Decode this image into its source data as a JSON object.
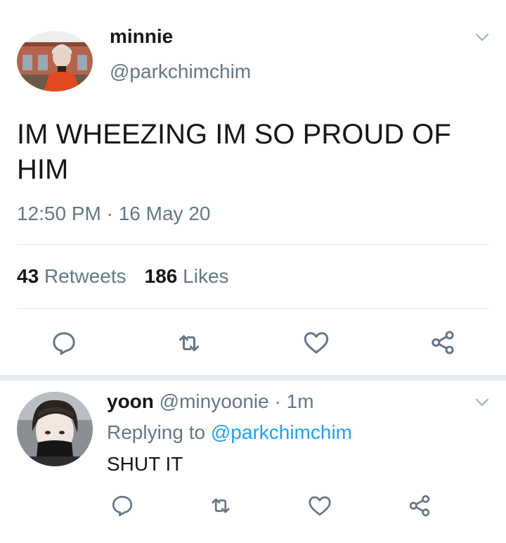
{
  "main_tweet": {
    "name": "minnie",
    "handle": "@parkchimchim",
    "text": "IM WHEEZING IM SO PROUD OF HIM",
    "timestamp": "12:50 PM · 16 May 20",
    "retweets_count": "43",
    "retweets_label": "Retweets",
    "likes_count": "186",
    "likes_label": "Likes"
  },
  "reply_tweet": {
    "name": "yoon",
    "handle": "@minyoonie",
    "time": "· 1m",
    "replying_prefix": "Replying to",
    "replying_handle": "@parkchimchim",
    "text": "SHUT IT"
  },
  "icons": [
    "chevron-down-icon",
    "reply-icon",
    "retweet-icon",
    "like-icon",
    "share-icon"
  ],
  "colors": {
    "text_primary": "#14171a",
    "text_secondary": "#657786",
    "link": "#1da1f2",
    "divider": "#e1e8ed",
    "section_separator": "#e6ecf0"
  }
}
